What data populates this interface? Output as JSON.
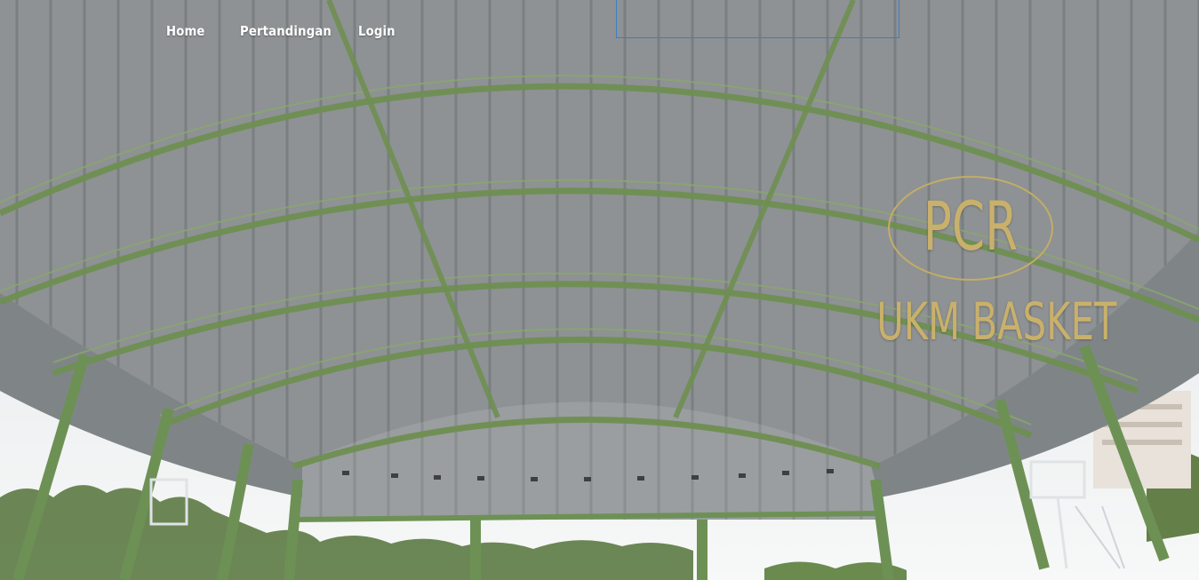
{
  "nav": {
    "items": [
      {
        "label": "Home"
      },
      {
        "label": "Pertandingan"
      },
      {
        "label": "Login"
      }
    ]
  },
  "brand": {
    "logo_text": "PCR",
    "title": "UKM BASKET"
  },
  "colors": {
    "gold": "#c9b06b",
    "frame_green": "#6f8f52",
    "search_border": "#3a7fc4"
  },
  "hero": {
    "image": "covered-basketball-court-roof"
  }
}
